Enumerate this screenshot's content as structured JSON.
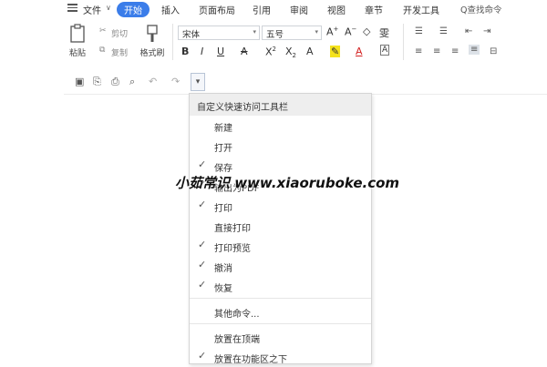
{
  "menubar": {
    "file": "文件",
    "file_arrow": "∨",
    "tabs": [
      "开始",
      "插入",
      "页面布局",
      "引用",
      "审阅",
      "视图",
      "章节",
      "开发工具"
    ],
    "search": "Q查找命令"
  },
  "ribbon": {
    "paste": "粘贴",
    "cut": "剪切",
    "copy": "复制",
    "format_painter": "格式刷",
    "font_name": "宋体",
    "font_size": "五号"
  },
  "dropdown": {
    "header": "自定义快速访问工具栏",
    "items": [
      {
        "label": "新建",
        "checked": false
      },
      {
        "label": "打开",
        "checked": false
      },
      {
        "label": "保存",
        "checked": true
      },
      {
        "label": "输出为PDF",
        "checked": true
      },
      {
        "label": "打印",
        "checked": true
      },
      {
        "label": "直接打印",
        "checked": false
      },
      {
        "label": "打印预览",
        "checked": true
      },
      {
        "label": "撤消",
        "checked": true
      },
      {
        "label": "恢复",
        "checked": true
      }
    ],
    "more": "其他命令...",
    "place_top": "放置在顶端",
    "place_below": "放置在功能区之下",
    "check_glyph": "✓"
  },
  "watermark": "小茹常识 www.xiaoruboke.com"
}
